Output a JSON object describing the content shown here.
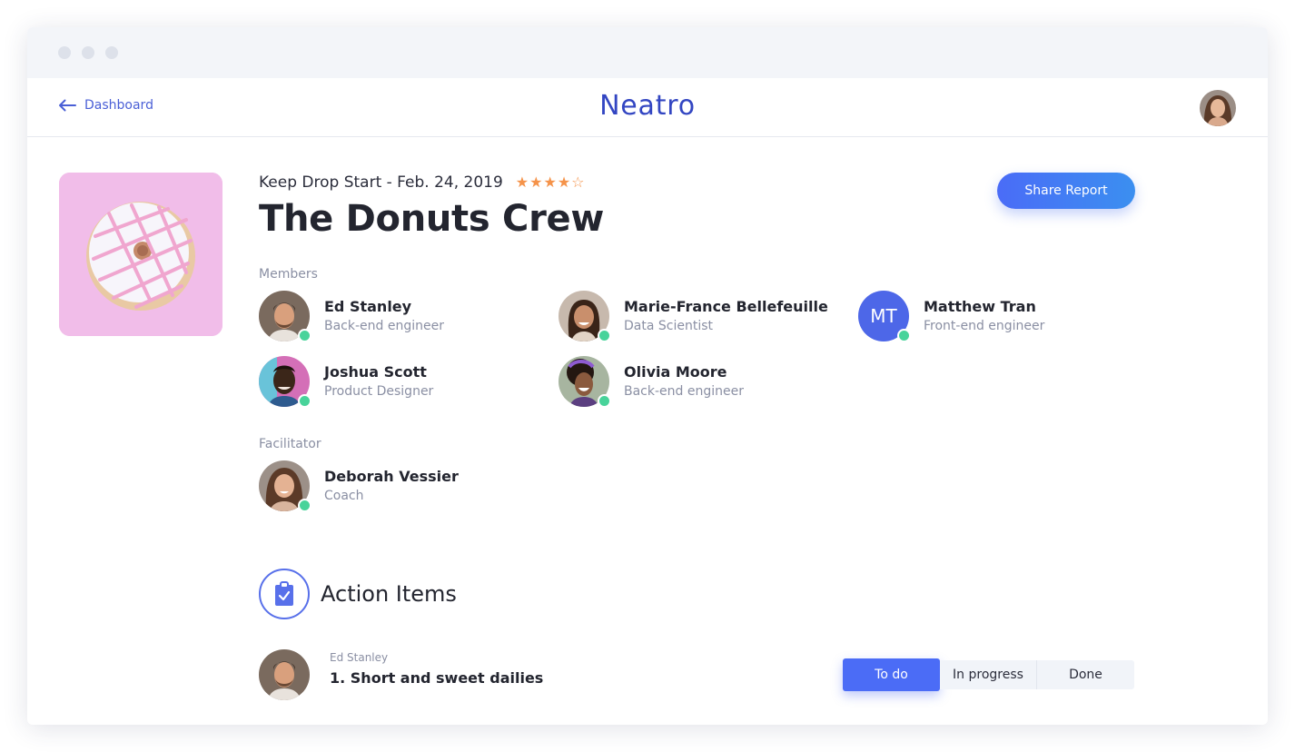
{
  "nav": {
    "back_label": "Dashboard",
    "logo": "Neatro"
  },
  "report": {
    "subtitle": "Keep Drop Start - Feb. 24, 2019",
    "rating": 4,
    "rating_max": 5,
    "team_name": "The Donuts Crew",
    "share_label": "Share Report"
  },
  "members": {
    "label": "Members",
    "list": [
      {
        "name": "Ed Stanley",
        "role": "Back-end engineer",
        "online": true,
        "avatar": "photo"
      },
      {
        "name": "Marie-France Bellefeuille",
        "role": "Data Scientist",
        "online": true,
        "avatar": "photo"
      },
      {
        "name": "Matthew Tran",
        "role": "Front-end engineer",
        "online": true,
        "initials": "MT"
      },
      {
        "name": "Joshua Scott",
        "role": "Product Designer",
        "online": true,
        "avatar": "photo"
      },
      {
        "name": "Olivia Moore",
        "role": "Back-end engineer",
        "online": true,
        "avatar": "photo"
      }
    ]
  },
  "facilitator": {
    "label": "Facilitator",
    "name": "Deborah Vessier",
    "role": "Coach",
    "online": true
  },
  "action_items": {
    "title": "Action Items",
    "icon": "clipboard-check-icon",
    "items": [
      {
        "owner": "Ed Stanley",
        "text": "1. Short and sweet dailies",
        "status": "To do"
      }
    ],
    "statuses": [
      "To do",
      "In progress",
      "Done"
    ]
  },
  "colors": {
    "brand": "#3346c2",
    "accent": "#4b6cf6",
    "online": "#48d39a",
    "star": "#f5934a"
  }
}
